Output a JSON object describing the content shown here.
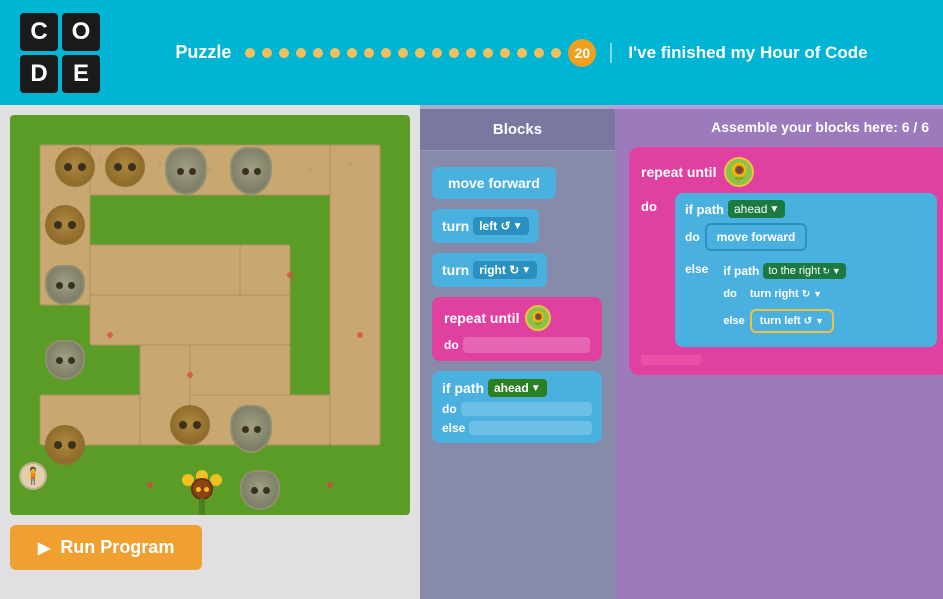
{
  "header": {
    "logo": [
      "C",
      "O",
      "D",
      "E"
    ],
    "puzzle_label": "Puzzle",
    "puzzle_number": "20",
    "finished_message": "I've finished my Hour of Code",
    "dots_before": 19,
    "dots_after": 0
  },
  "game": {
    "run_button_label": "Run Program"
  },
  "blocks_panel": {
    "header": "Blocks",
    "blocks": [
      {
        "id": "move-forward",
        "label": "move forward",
        "type": "blue"
      },
      {
        "id": "turn-left",
        "label": "turn",
        "dropdown": "left",
        "symbol": "↺",
        "type": "blue"
      },
      {
        "id": "turn-right",
        "label": "turn",
        "dropdown": "right",
        "symbol": "↻",
        "type": "blue"
      },
      {
        "id": "repeat-until",
        "label": "repeat until",
        "type": "pink"
      },
      {
        "id": "if-path",
        "label": "if path",
        "dropdown": "ahead",
        "type": "blue"
      }
    ]
  },
  "code_panel": {
    "header": "Assemble your blocks here: 6 / 6",
    "workspace": {
      "repeat_label": "repeat until",
      "do_label": "do",
      "else_label": "else",
      "if_path_ahead": "if path",
      "ahead_dd": "ahead",
      "move_forward": "move forward",
      "to_the_right": "to the right",
      "turn_right": "turn right",
      "turn_left": "turn left",
      "right_sym": "↻",
      "left_sym": "↺"
    }
  }
}
